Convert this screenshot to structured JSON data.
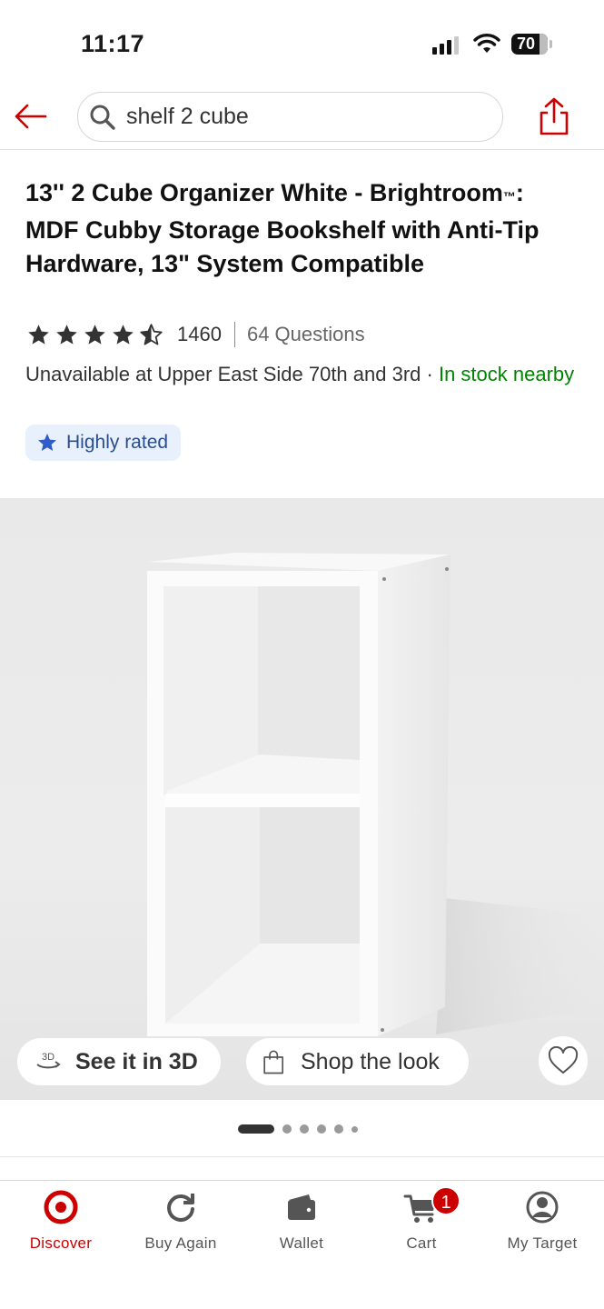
{
  "status_bar": {
    "time": "11:17",
    "battery": "70"
  },
  "search": {
    "value": "shelf 2 cube",
    "placeholder": "Search"
  },
  "product": {
    "title_main": "13'' 2 Cube Organizer White - Brightroom",
    "title_tm": "™",
    "title_rest": ": MDF Cubby Storage Bookshelf with Anti-Tip Hardware, 13\" System Compatible",
    "rating": 4.5,
    "rating_count": "1460",
    "questions": "64 Questions",
    "availability": "Unavailable at Upper East Side 70th and 3rd · ",
    "stock": "In stock nearby",
    "badge": "Highly rated"
  },
  "hero": {
    "see_3d": "See it in 3D",
    "shop_look": "Shop the look",
    "icon_3d": "3D"
  },
  "pager": {
    "current": 1,
    "total": 6
  },
  "tabs": [
    {
      "label": "Discover",
      "icon": "target-logo-icon",
      "active": true
    },
    {
      "label": "Buy Again",
      "icon": "refresh-icon"
    },
    {
      "label": "Wallet",
      "icon": "wallet-icon"
    },
    {
      "label": "Cart",
      "icon": "cart-icon",
      "badge": "1"
    },
    {
      "label": "My Target",
      "icon": "profile-icon"
    }
  ],
  "colors": {
    "brand": "#cc0000",
    "in_stock": "#008300",
    "badge_bg": "#e8f0fb",
    "badge_text": "#2a4d8f"
  }
}
